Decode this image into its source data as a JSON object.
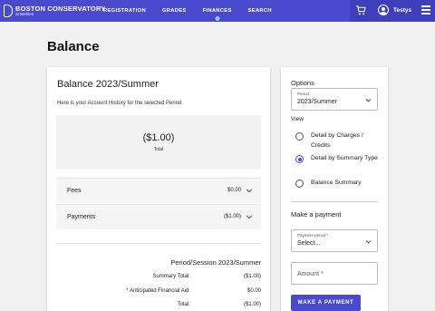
{
  "header": {
    "brand_name": "BOSTON CONSERVATORY",
    "brand_sub": "at Berklee",
    "nav": [
      {
        "label": "REGISTRATION"
      },
      {
        "label": "GRADES"
      },
      {
        "label": "FINANCES"
      },
      {
        "label": "SEARCH"
      }
    ],
    "active_nav": "FINANCES",
    "user_name": "Testys",
    "icons": [
      "cart-icon",
      "user-icon",
      "menu-icon"
    ],
    "colors": {
      "bar": "#4a4acf",
      "bar_right": "#3f3fbd",
      "active_dot": "#8fd0ff"
    }
  },
  "page": {
    "title": "Balance"
  },
  "balance": {
    "title": "Balance 2023/Summer",
    "subtitle": "Here is your Account History for the selected Period.",
    "total_amount": "($1.00)",
    "total_label": "Total",
    "rows": [
      {
        "label": "Fees",
        "amount": "$0.00"
      },
      {
        "label": "Payments",
        "amount": "($1.00)"
      }
    ],
    "period_title": "Period/Session 2023/Summer",
    "summary": [
      {
        "label": "Summary Total:",
        "value": "($1.00)"
      },
      {
        "label": "* Anticipated Financial Aid:",
        "value": "$0.00"
      },
      {
        "label": "Total:",
        "value": "($1.00)"
      }
    ]
  },
  "options": {
    "title": "Options",
    "period_label": "Period",
    "period_value": "2023/Summer",
    "view_label": "View",
    "view_options": [
      {
        "label": "Detail by Charges / Credits",
        "checked": false
      },
      {
        "label": "Detail by Summary Type",
        "checked": true
      },
      {
        "label": "Balance Summary",
        "checked": false
      }
    ],
    "payment_title": "Make a payment",
    "payment_period_label": "Payment period *",
    "payment_period_value": "Select...",
    "amount_placeholder": "Amount *",
    "pay_button": "MAKE A PAYMENT",
    "accent": "#4a4acf"
  }
}
